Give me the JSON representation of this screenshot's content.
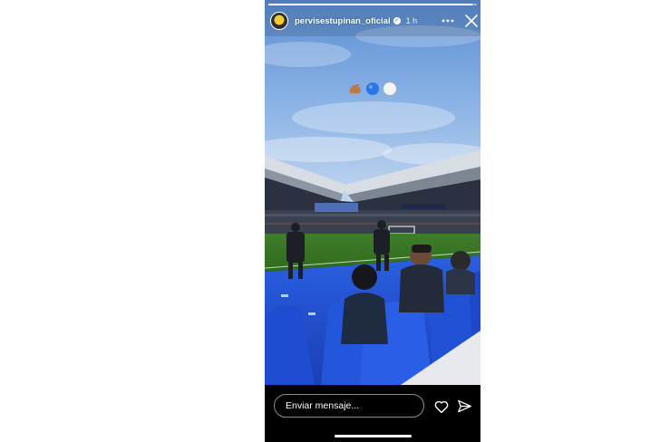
{
  "story": {
    "username": "pervisestupinan_oficial",
    "verified": true,
    "time": "1 h",
    "progress": 0.98,
    "emojis": [
      "flexed-biceps-emoji",
      "blue-circle-emoji",
      "white-circle-emoji"
    ],
    "icons": {
      "avatar": "avatar",
      "verified": "verified-badge-icon",
      "more": "more-icon",
      "close": "close-icon",
      "like": "heart-icon",
      "share": "send-icon"
    },
    "colors": {
      "background": "#000000",
      "pitch": "#2f6f1f",
      "seats": "#1d4fd1",
      "sky": "#7aa7e4"
    }
  },
  "footer": {
    "message_placeholder": "Enviar mensaje..."
  }
}
